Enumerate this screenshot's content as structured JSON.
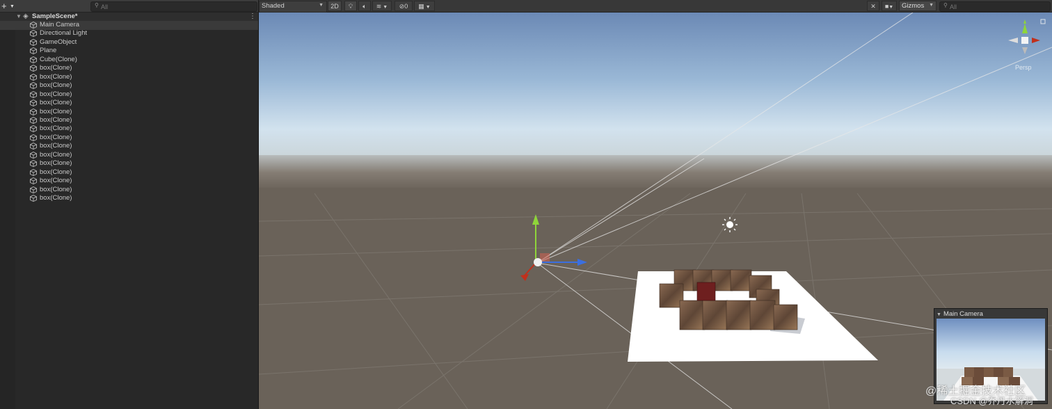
{
  "hierarchy": {
    "add_icon": "plus-icon",
    "search": {
      "placeholder": "All"
    },
    "scene_name": "SampleScene*",
    "items": [
      "Main Camera",
      "Directional Light",
      "GameObject",
      "Plane",
      "Cube(Clone)",
      "box(Clone)",
      "box(Clone)",
      "box(Clone)",
      "box(Clone)",
      "box(Clone)",
      "box(Clone)",
      "box(Clone)",
      "box(Clone)",
      "box(Clone)",
      "box(Clone)",
      "box(Clone)",
      "box(Clone)",
      "box(Clone)",
      "box(Clone)",
      "box(Clone)",
      "box(Clone)"
    ],
    "selected": "Main Camera"
  },
  "scene_toolbar": {
    "shading_mode": "Shaded",
    "mode_2d": "2D",
    "hidden_count": "0",
    "gizmos_label": "Gizmos",
    "search": {
      "placeholder": "All"
    }
  },
  "scene_view": {
    "orientation_gizmo_label": "Persp",
    "camera_preview_title": "Main Camera"
  },
  "watermark": {
    "line1": "@稀土掘金技术社区",
    "line2": "CSDN @乔丹水解洞"
  },
  "colors": {
    "sky_top": "#6e8bb6",
    "horizon": "#c9dcec",
    "ground": "#6a6259",
    "axis_y": "#8fd53a",
    "axis_x": "#c0301c",
    "axis_z": "#3b6fe0",
    "plane": "#ffffff",
    "box": "#7a5a44"
  }
}
